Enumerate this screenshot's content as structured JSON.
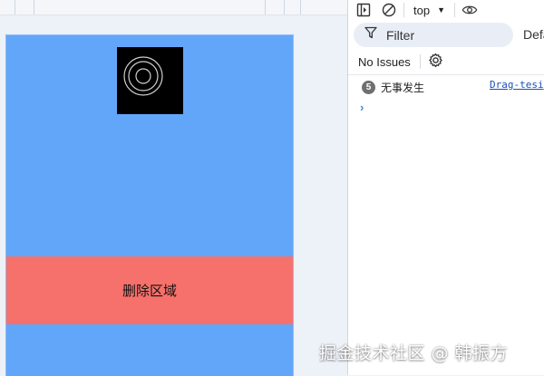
{
  "preview": {
    "delete_zone_label": "删除区域",
    "colors": {
      "page_bg": "#62a6fa",
      "delete_zone_bg": "#f6716b",
      "drag_box_bg": "#000000"
    }
  },
  "devtools": {
    "toolbar": {
      "sidebar_toggle_icon": "sidebar-toggle-icon",
      "clear_icon": "clear-console-icon",
      "context_label": "top",
      "eye_icon": "live-expression-eye-icon"
    },
    "filter": {
      "label": "Filter",
      "default_levels_label": "Defa"
    },
    "issues": {
      "label": "No Issues",
      "settings_icon": "gear-icon"
    },
    "log": {
      "count": "5",
      "message": "无事发生",
      "source": "Drag-tesi"
    },
    "prompt_symbol": "›"
  },
  "watermark": "掘金技术社区 @ 韩振方"
}
